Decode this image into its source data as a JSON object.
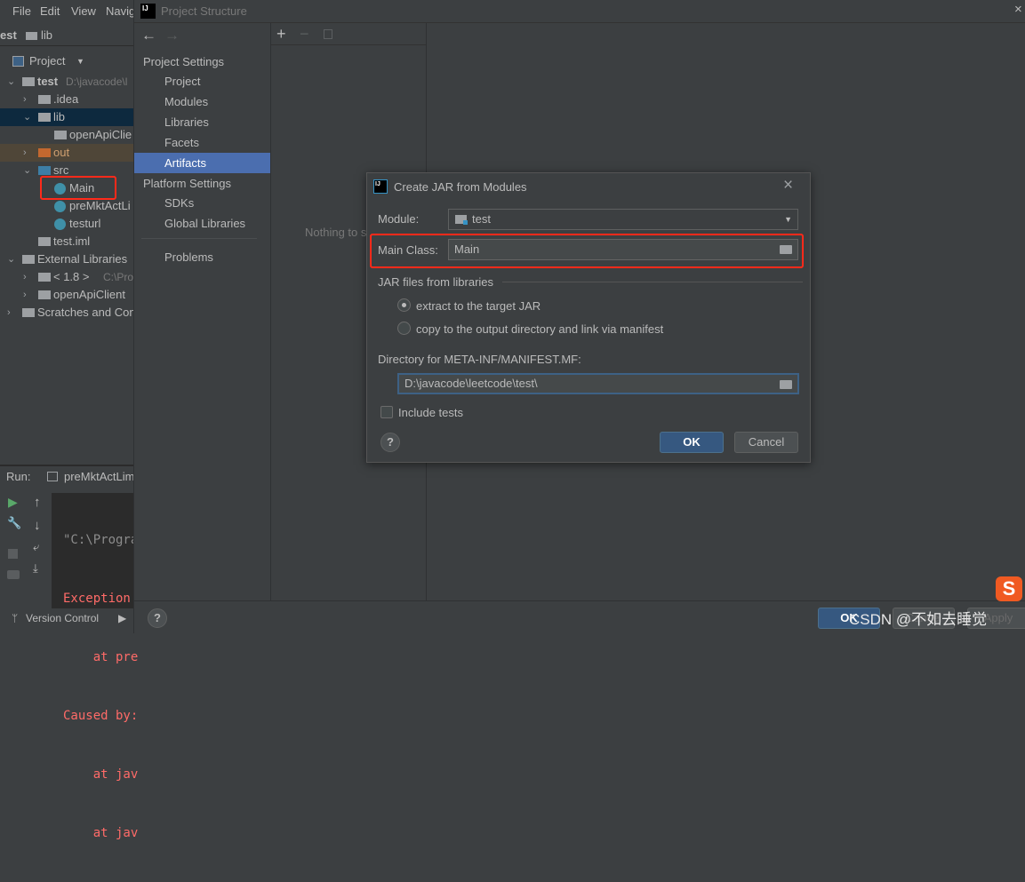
{
  "ide": {
    "menu": [
      "File",
      "Edit",
      "View",
      "Navig"
    ],
    "breadcrumb": [
      "est",
      "lib"
    ],
    "project_view_label": "Project",
    "tree": [
      {
        "label": "test",
        "extra": "D:\\javacode\\l",
        "level": 0,
        "bold": true
      },
      {
        "label": ".idea",
        "level": 1
      },
      {
        "label": "lib",
        "level": 1,
        "selected": true
      },
      {
        "label": "openApiClie",
        "level": 2
      },
      {
        "label": "out",
        "level": 1,
        "excluded": true
      },
      {
        "label": "src",
        "level": 1
      },
      {
        "label": "Main",
        "level": 2,
        "highlighted": true
      },
      {
        "label": "preMktActLi",
        "level": 2
      },
      {
        "label": "testurl",
        "level": 2
      },
      {
        "label": "test.iml",
        "level": 1
      },
      {
        "label": "External Libraries",
        "level": 0
      },
      {
        "label": "< 1.8 >",
        "extra": "C:\\Prog",
        "level": 1
      },
      {
        "label": "openApiClient",
        "level": 1
      },
      {
        "label": "Scratches and Con",
        "level": 0
      }
    ],
    "run": {
      "label": "Run:",
      "tab": "preMktActLim",
      "console": [
        "\"C:\\Progra",
        "Exception",
        "    at pre",
        "Caused by:",
        "    at jav",
        "    at jav"
      ]
    },
    "bottom_tabs": [
      "Version Control"
    ]
  },
  "project_structure": {
    "title": "Project Structure",
    "sections": [
      {
        "header": "Project Settings",
        "items": [
          "Project",
          "Modules",
          "Libraries",
          "Facets",
          "Artifacts"
        ]
      },
      {
        "header": "Platform Settings",
        "items": [
          "SDKs",
          "Global Libraries"
        ]
      }
    ],
    "selected_item": "Artifacts",
    "problems": "Problems",
    "empty_text": "Nothing to s",
    "buttons": {
      "ok": "OK",
      "cancel": "Cancel",
      "apply": "Apply"
    }
  },
  "dialog": {
    "title": "Create JAR from Modules",
    "module_label": "Module:",
    "module_value": "test",
    "main_class_label": "Main Class:",
    "main_class_value": "Main",
    "jar_group_label": "JAR files from libraries",
    "options": [
      "extract to the target JAR",
      "copy to the output directory and link via manifest"
    ],
    "selected_option": 0,
    "manifest_label": "Directory for META-INF/MANIFEST.MF:",
    "manifest_value": "D:\\javacode\\leetcode\\test\\",
    "include_tests_label": "Include tests",
    "include_tests": false,
    "ok": "OK",
    "cancel": "Cancel"
  },
  "watermark": "CSDN @不如去睡觉",
  "colors": {
    "selection": "#4b6eaf",
    "highlight": "#ff2a1a",
    "ok_button": "#365880"
  }
}
